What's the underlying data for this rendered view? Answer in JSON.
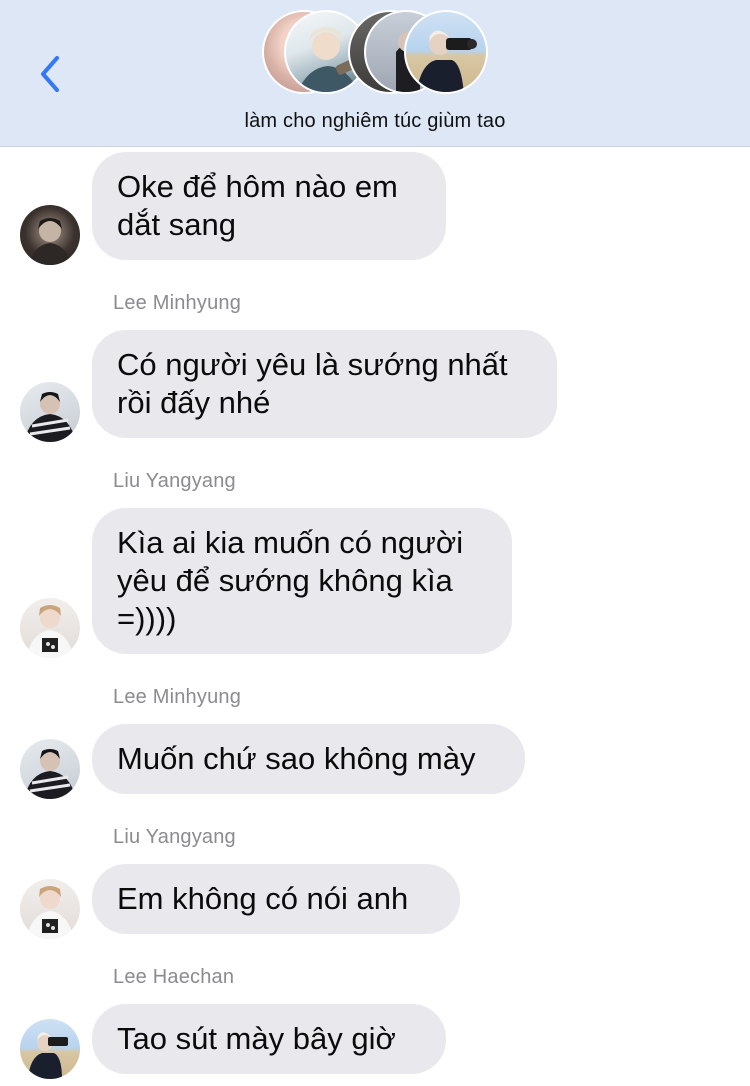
{
  "header": {
    "title": "làm cho nghiêm túc giùm tao",
    "back_icon": "chevron-left-icon",
    "accent_color": "#3478f6",
    "background": "#dde7f6"
  },
  "messages": [
    {
      "sender": "",
      "text": "Oke để hôm nào em\ndắt sang"
    },
    {
      "sender": "Lee Minhyung",
      "text": "Có người yêu là sướng nhất\nrồi đấy nhé"
    },
    {
      "sender": "Liu Yangyang",
      "text": "Kìa ai kia muốn có người\nyêu để sướng không kìa\n=))))"
    },
    {
      "sender": "Lee Minhyung",
      "text": "Muốn chứ sao không mày"
    },
    {
      "sender": "Liu Yangyang",
      "text": "Em không có nói anh"
    },
    {
      "sender": "Lee Haechan",
      "text": "Tao sút mày bây giờ"
    }
  ]
}
